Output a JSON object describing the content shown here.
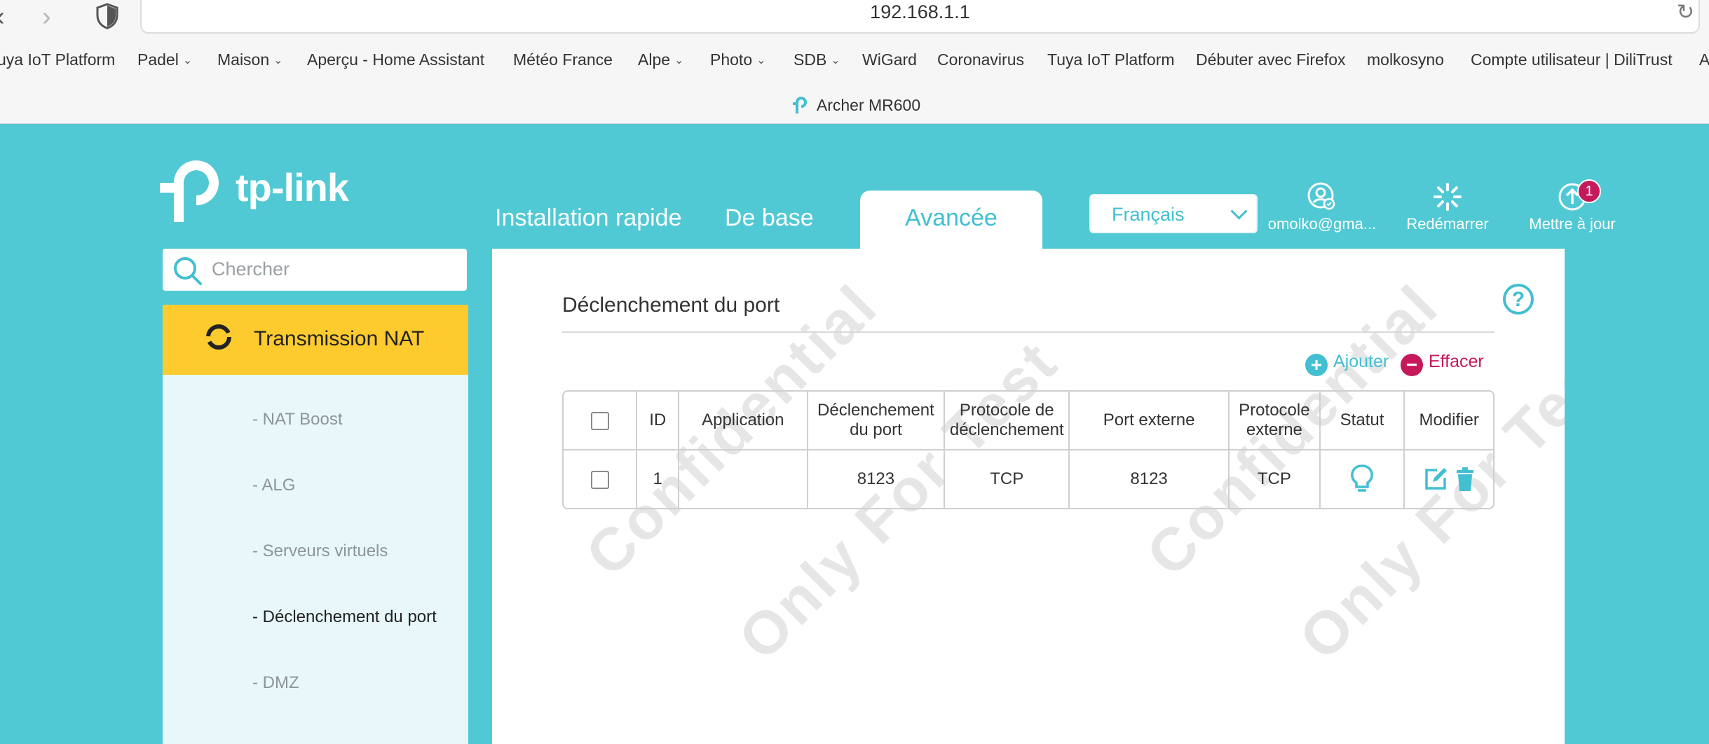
{
  "browser": {
    "url": "192.168.1.1",
    "tab_title": "Archer MR600",
    "bookmarks": [
      {
        "label": "uya IoT Platform",
        "has_menu": false
      },
      {
        "label": "Padel",
        "has_menu": true
      },
      {
        "label": "Maison",
        "has_menu": true
      },
      {
        "label": "Aperçu - Home Assistant",
        "has_menu": false
      },
      {
        "label": "Météo France",
        "has_menu": false
      },
      {
        "label": "Alpe",
        "has_menu": true
      },
      {
        "label": "Photo",
        "has_menu": true
      },
      {
        "label": "SDB",
        "has_menu": true
      },
      {
        "label": "WiGard",
        "has_menu": false
      },
      {
        "label": "Coronavirus",
        "has_menu": false
      },
      {
        "label": "Tuya IoT Platform",
        "has_menu": false
      },
      {
        "label": "Débuter avec Firefox",
        "has_menu": false
      },
      {
        "label": "molkosyno",
        "has_menu": false
      },
      {
        "label": "Compte utilisateur | DiliTrust",
        "has_menu": false
      },
      {
        "label": "A",
        "has_menu": false
      }
    ],
    "icons": [
      "back-icon",
      "forward-icon",
      "shield-icon",
      "reload-icon"
    ]
  },
  "router": {
    "brand": "tp-link",
    "tabs": {
      "quick_setup": "Installation rapide",
      "basic": "De base",
      "advanced": "Avancée"
    },
    "language": "Français",
    "account": "omolko@gma...",
    "reboot": "Redémarrer",
    "update": "Mettre à jour",
    "update_badge": "1",
    "search_placeholder": "Chercher",
    "sidebar": {
      "section": "Transmission NAT",
      "items": [
        {
          "label": "- NAT Boost",
          "active": false
        },
        {
          "label": "- ALG",
          "active": false
        },
        {
          "label": "- Serveurs virtuels",
          "active": false
        },
        {
          "label": "- Déclenchement du port",
          "active": true
        },
        {
          "label": "- DMZ",
          "active": false
        }
      ]
    },
    "main": {
      "title": "Déclenchement du port",
      "add": "Ajouter",
      "delete": "Effacer",
      "watermark_1": "Confidential",
      "watermark_2": "Only For Test",
      "columns": [
        "ID",
        "Application",
        "Déclenchement du port",
        "Protocole de déclenchement",
        "Port externe",
        "Protocole externe",
        "Statut",
        "Modifier"
      ],
      "rows": [
        {
          "id": "1",
          "application": "",
          "trigger_port": "8123",
          "trigger_protocol": "TCP",
          "external_port": "8123",
          "external_protocol": "TCP",
          "status_icon": "bulb-icon",
          "edit_icon": "edit-icon",
          "delete_icon": "trash-icon"
        }
      ]
    },
    "colors": {
      "teal": "#51c9d4",
      "accent": "#42bfd0",
      "yellow": "#fecb2f",
      "magenta": "#c5195c"
    }
  }
}
